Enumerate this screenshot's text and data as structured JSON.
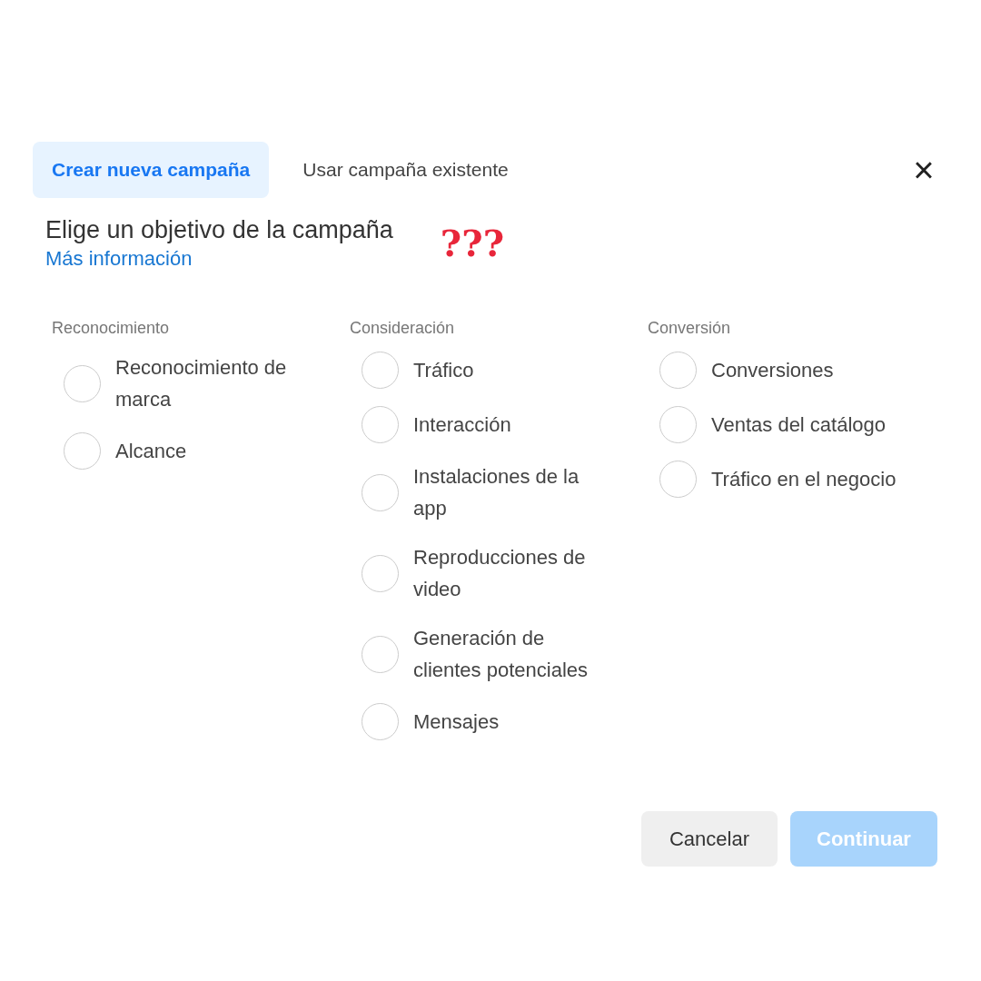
{
  "tabs": [
    {
      "label": "Crear nueva campaña",
      "selected": true
    },
    {
      "label": "Usar campaña existente",
      "selected": false
    }
  ],
  "close": "×",
  "heading": "Elige un objetivo de la campaña",
  "annotation": "???",
  "link": "Más información",
  "groups": [
    {
      "title": "Reconocimiento",
      "options": [
        {
          "label": "Reconocimiento de marca",
          "selected": false
        },
        {
          "label": "Alcance",
          "selected": false
        }
      ]
    },
    {
      "title": "Consideración",
      "options": [
        {
          "label": "Tráfico",
          "selected": false
        },
        {
          "label": "Interacción",
          "selected": false
        },
        {
          "label": "Instalaciones de la app",
          "selected": false
        },
        {
          "label": "Reproducciones de video",
          "selected": false
        },
        {
          "label": "Generación de clientes potenciales",
          "selected": false
        },
        {
          "label": "Mensajes",
          "selected": false
        }
      ]
    },
    {
      "title": "Conversión",
      "options": [
        {
          "label": "Conversiones",
          "selected": false
        },
        {
          "label": "Ventas del catálogo",
          "selected": false
        },
        {
          "label": "Tráfico en el negocio",
          "selected": false
        }
      ]
    }
  ],
  "buttons": [
    {
      "label": "Cancelar",
      "kind": "secondary",
      "disabled": false
    },
    {
      "label": "Continuar",
      "kind": "primary",
      "disabled": true
    }
  ]
}
